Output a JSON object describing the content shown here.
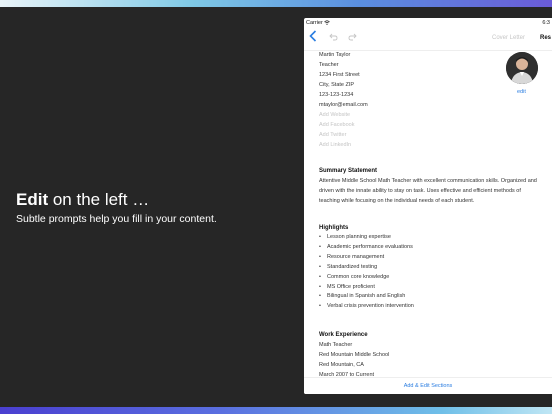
{
  "promo": {
    "title_bold": "Edit",
    "title_rest": " on the left …",
    "subtitle": "Subtle prompts help you fill in your content."
  },
  "status_bar": {
    "carrier": "Carrier",
    "wifi_icon": "wifi-icon",
    "time": "6:3"
  },
  "navbar": {
    "back_icon": "chevron-left-icon",
    "undo_icon": "undo-icon",
    "redo_icon": "redo-icon",
    "cover_letter": "Cover Letter",
    "resume": "Res"
  },
  "contact": {
    "name": "Martin Taylor",
    "title": "Teacher",
    "street": "1234 First Street",
    "city": "City, State ZIP",
    "phone": "123-123-1234",
    "email": "mtaylor@email.com",
    "placeholders": [
      "Add Website",
      "Add Facebook",
      "Add Twitter",
      "Add LinkedIn"
    ],
    "edit_label": "edit"
  },
  "summary": {
    "heading": "Summary Statement",
    "text": "Attentive Middle School Math Teacher with excellent communication skills. Organized and driven with the innate ability to stay on task. Uses effective and efficient methods of teaching while focusing on the individual needs of each student."
  },
  "highlights": {
    "heading": "Highlights",
    "items": [
      "Lesson planning expertise",
      "Academic performance evaluations",
      "Resource management",
      "Standardized testing",
      "Common core knowledge",
      "MS Office proficient",
      "Bilingual in Spanish and English",
      "Verbal crisis prevention intervention"
    ]
  },
  "work": {
    "heading": "Work Experience",
    "role": "Math Teacher",
    "employer": "Red Mountain Middle School",
    "location": "Red Mountain, CA",
    "dates": "March 2007 to Current"
  },
  "footer": {
    "add_edit_sections": "Add & Edit Sections"
  },
  "colors": {
    "accent": "#2a7de1",
    "background": "#262626"
  }
}
